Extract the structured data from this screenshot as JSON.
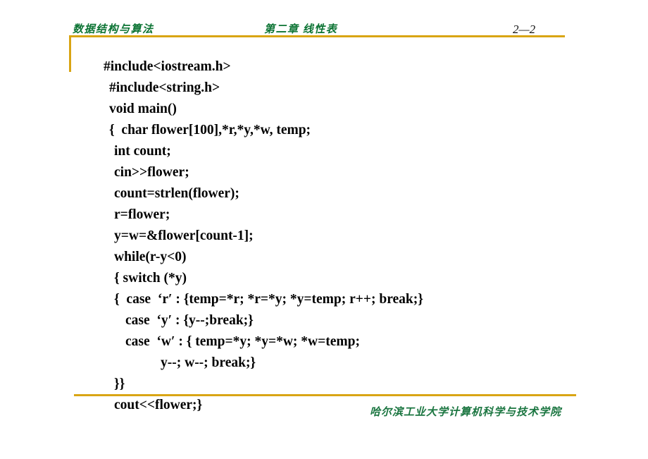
{
  "header": {
    "course_title": "数据结构与算法",
    "chapter_title": "第二章 线性表",
    "page_number": "2—2",
    "rule_color": "#d9a514",
    "text_color": "#0c7434"
  },
  "code": {
    "lines": [
      {
        "text": "#include<iostream.h>",
        "indent": 0
      },
      {
        "text": "#include<string.h>",
        "indent": 1
      },
      {
        "text": "void main()",
        "indent": 1
      },
      {
        "text": "{  char flower[100],*r,*y,*w, temp;",
        "indent": 1
      },
      {
        "text": "int count;",
        "indent": 2
      },
      {
        "text": "cin>>flower;",
        "indent": 2
      },
      {
        "text": "count=strlen(flower);",
        "indent": 2
      },
      {
        "text": "r=flower;",
        "indent": 2
      },
      {
        "text": "y=w=&flower[count-1];",
        "indent": 2
      },
      {
        "text": "while(r-y<0)",
        "indent": 2
      },
      {
        "text": "{ switch (*y)",
        "indent": 2
      },
      {
        "text": "{  case  ‘r′ : {temp=*r; *r=*y; *y=temp; r++; break;}",
        "indent": 2
      },
      {
        "text": "case  ‘y′ : {y--;break;}",
        "indent": 3
      },
      {
        "text": "case  ‘w′ : { temp=*y; *y=*w; *w=temp;",
        "indent": 3
      },
      {
        "text": "y--; w--; break;}",
        "indent": 4
      },
      {
        "text": "}}",
        "indent": 2
      },
      {
        "text": "cout<<flower;}",
        "indent": 2
      }
    ]
  },
  "footer": {
    "institution": "哈尔滨工业大学计算机科学与技术学院",
    "rule_color": "#d9a514",
    "text_color": "#1a7540"
  }
}
